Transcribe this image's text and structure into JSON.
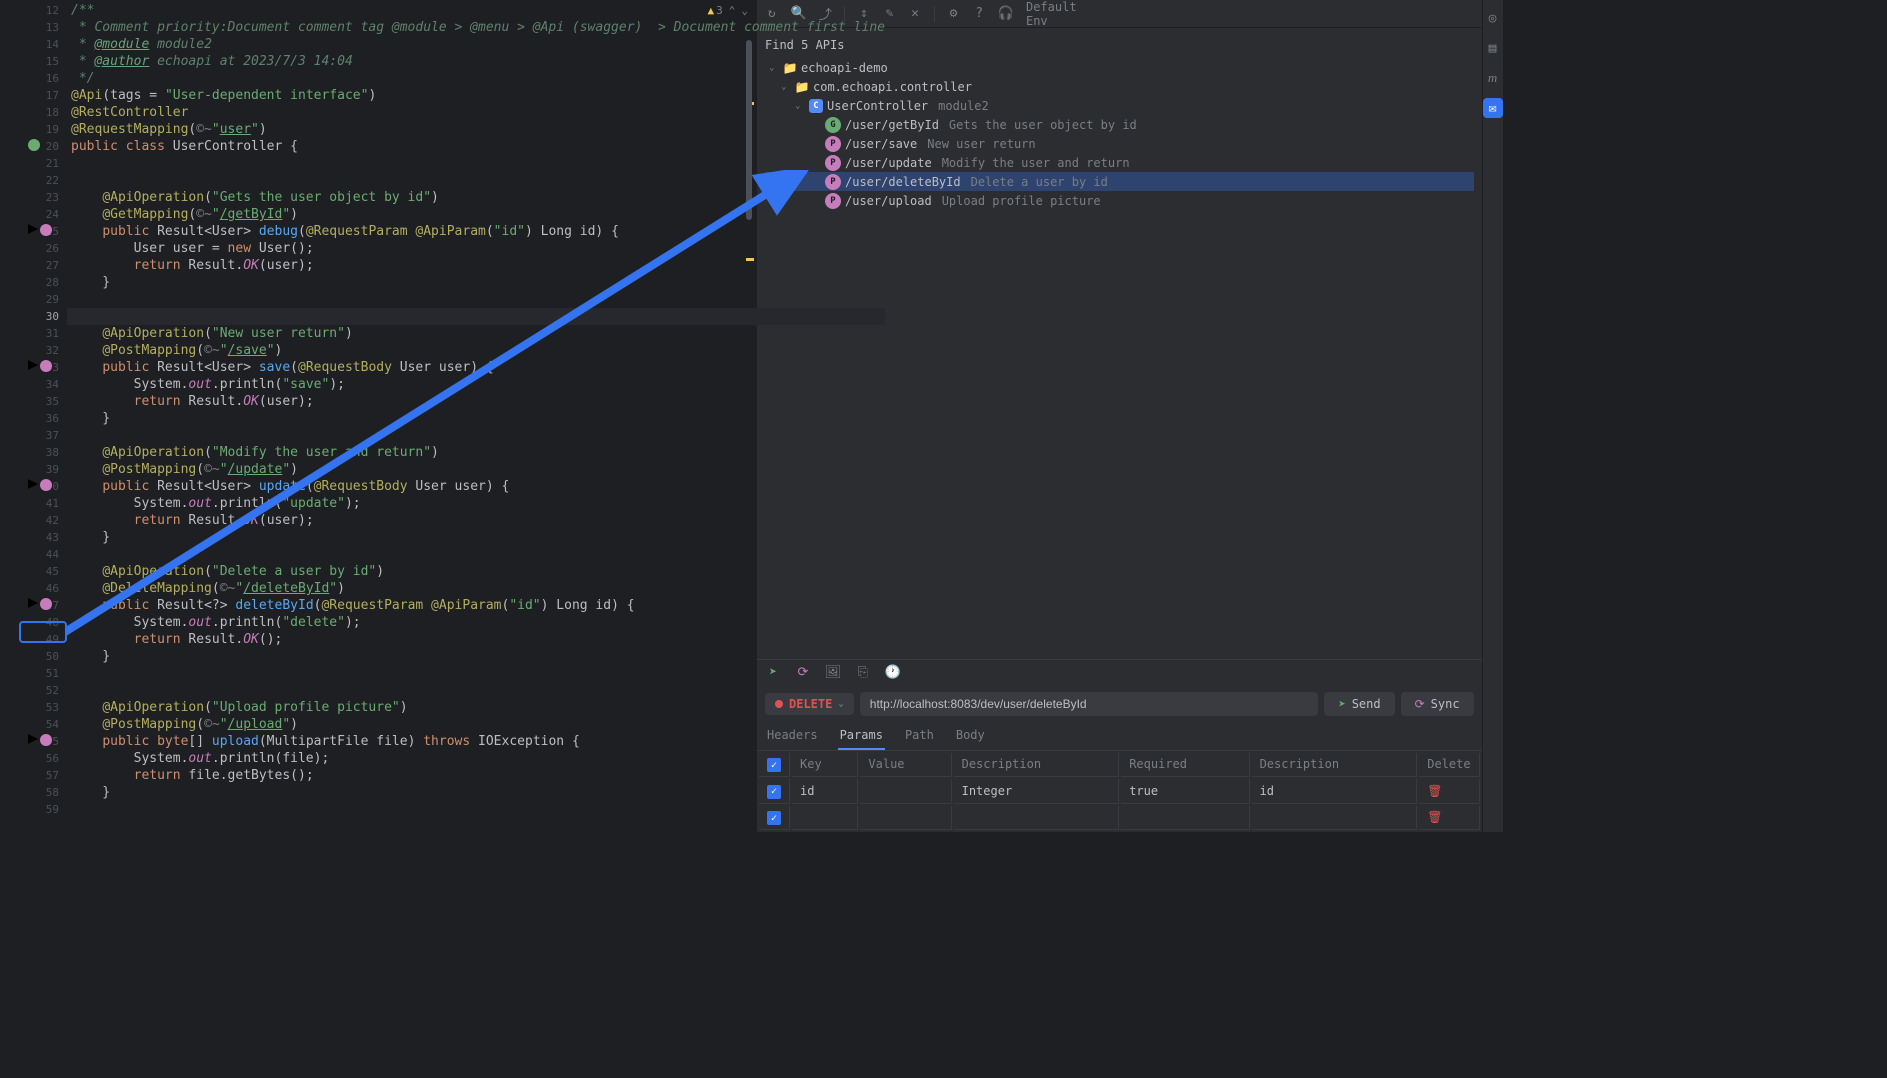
{
  "editor": {
    "warning_count": "3",
    "lines": [
      {
        "n": 12,
        "html": "<span class='c-doccomment'>/**</span>"
      },
      {
        "n": 13,
        "html": "<span class='c-doccomment'> * Comment priority:Document comment tag @module > @menu > @Api (swagger)  > Document comment first line</span>"
      },
      {
        "n": 14,
        "html": "<span class='c-doccomment'> * </span><span class='c-doctag'>@module</span><span class='c-doccomment'> module2</span>"
      },
      {
        "n": 15,
        "html": "<span class='c-doccomment'> * </span><span class='c-doctag'>@author</span><span class='c-doccomment'> echoapi at 2023/7/3 14:04</span>"
      },
      {
        "n": 16,
        "html": "<span class='c-doccomment'> */</span>"
      },
      {
        "n": 17,
        "html": "<span class='c-annotation'>@Api</span>(tags = <span class='c-string'>\"User-dependent interface\"</span>)"
      },
      {
        "n": 18,
        "html": "<span class='c-annotation'>@RestController</span>"
      },
      {
        "n": 19,
        "html": "<span class='c-annotation'>@RequestMapping</span>(<span class='c-comment'>©~</span><span class='c-string'>\"<u>user</u>\"</span>)"
      },
      {
        "n": 20,
        "html": "<span class='c-keyword'>public class</span> UserController {",
        "icon": "class"
      },
      {
        "n": 21,
        "html": ""
      },
      {
        "n": 22,
        "html": ""
      },
      {
        "n": 23,
        "html": "    <span class='c-annotation'>@ApiOperation</span>(<span class='c-string'>\"Gets the user object by id\"</span>)"
      },
      {
        "n": 24,
        "html": "    <span class='c-annotation'>@GetMapping</span>(<span class='c-comment'>©~</span><span class='c-string'>\"<u>/getById</u>\"</span>)"
      },
      {
        "n": 25,
        "html": "    <span class='c-keyword'>public</span> Result&lt;User&gt; <span class='c-method'>debug</span>(<span class='c-annotation'>@RequestParam @ApiParam</span>(<span class='c-string'>\"id\"</span>) Long id) {",
        "icon": "run"
      },
      {
        "n": 26,
        "html": "        User user = <span class='c-keyword'>new</span> User();"
      },
      {
        "n": 27,
        "html": "        <span class='c-keyword'>return</span> Result.<span class='c-static'>OK</span>(user);"
      },
      {
        "n": 28,
        "html": "    }"
      },
      {
        "n": 29,
        "html": ""
      },
      {
        "n": 30,
        "html": "",
        "hl": true
      },
      {
        "n": 31,
        "html": "    <span class='c-annotation'>@ApiOperation</span>(<span class='c-string'>\"New user return\"</span>)"
      },
      {
        "n": 32,
        "html": "    <span class='c-annotation'>@PostMapping</span>(<span class='c-comment'>©~</span><span class='c-string'>\"<u>/save</u>\"</span>)"
      },
      {
        "n": 33,
        "html": "    <span class='c-keyword'>public</span> Result&lt;User&gt; <span class='c-method'>save</span>(<span class='c-annotation'>@RequestBody</span> User user) {",
        "icon": "run"
      },
      {
        "n": 34,
        "html": "        System.<span class='c-static'>out</span>.println(<span class='c-string'>\"save\"</span>);"
      },
      {
        "n": 35,
        "html": "        <span class='c-keyword'>return</span> Result.<span class='c-static'>OK</span>(user);"
      },
      {
        "n": 36,
        "html": "    }"
      },
      {
        "n": 37,
        "html": ""
      },
      {
        "n": 38,
        "html": "    <span class='c-annotation'>@ApiOperation</span>(<span class='c-string'>\"Modify the user and return\"</span>)"
      },
      {
        "n": 39,
        "html": "    <span class='c-annotation'>@PostMapping</span>(<span class='c-comment'>©~</span><span class='c-string'>\"<u>/update</u>\"</span>)"
      },
      {
        "n": 40,
        "html": "    <span class='c-keyword'>public</span> Result&lt;User&gt; <span class='c-method'>update</span>(<span class='c-annotation'>@RequestBody</span> User user) {",
        "icon": "run"
      },
      {
        "n": 41,
        "html": "        System.<span class='c-static'>out</span>.println(<span class='c-string'>\"update\"</span>);"
      },
      {
        "n": 42,
        "html": "        <span class='c-keyword'>return</span> Result.<span class='c-static'>OK</span>(user);"
      },
      {
        "n": 43,
        "html": "    }"
      },
      {
        "n": 44,
        "html": ""
      },
      {
        "n": 45,
        "html": "    <span class='c-annotation'>@ApiOperation</span>(<span class='c-string'>\"Delete a user by id\"</span>)"
      },
      {
        "n": 46,
        "html": "    <span class='c-annotation'>@DeleteMapping</span>(<span class='c-comment'>©~</span><span class='c-string'>\"<u>/deleteById</u>\"</span>)"
      },
      {
        "n": 47,
        "html": "    <span class='c-keyword'>public</span> Result&lt;?&gt; <span class='c-method'>deleteById</span>(<span class='c-annotation'>@RequestParam @ApiParam</span>(<span class='c-string'>\"id\"</span>) Long id) {",
        "icon": "run"
      },
      {
        "n": 48,
        "html": "        System.<span class='c-static'>out</span>.println(<span class='c-string'>\"delete\"</span>);"
      },
      {
        "n": 49,
        "html": "        <span class='c-keyword'>return</span> Result.<span class='c-static'>OK</span>();"
      },
      {
        "n": 50,
        "html": "    }"
      },
      {
        "n": 51,
        "html": ""
      },
      {
        "n": 52,
        "html": ""
      },
      {
        "n": 53,
        "html": "    <span class='c-annotation'>@ApiOperation</span>(<span class='c-string'>\"Upload profile picture\"</span>)"
      },
      {
        "n": 54,
        "html": "    <span class='c-annotation'>@PostMapping</span>(<span class='c-comment'>©~</span><span class='c-string'>\"<u>/upload</u>\"</span>)"
      },
      {
        "n": 55,
        "html": "    <span class='c-keyword'>public byte</span>[] <span class='c-method'>upload</span>(MultipartFile file) <span class='c-keyword'>throws</span> IOException {",
        "icon": "run"
      },
      {
        "n": 56,
        "html": "        System.<span class='c-static'>out</span>.println(file);"
      },
      {
        "n": 57,
        "html": "        <span class='c-keyword'>return</span> file.getBytes();"
      },
      {
        "n": 58,
        "html": "    }"
      },
      {
        "n": 59,
        "html": ""
      }
    ]
  },
  "api_panel": {
    "env_label": "Default Env",
    "find_title": "Find 5 APIs",
    "tree": {
      "project": "echoapi-demo",
      "package": "com.echoapi.controller",
      "controller": "UserController",
      "module": "module2",
      "endpoints": [
        {
          "method": "G",
          "cls": "http-get",
          "path": "/user/getById",
          "desc": "Gets the user object by id"
        },
        {
          "method": "P",
          "cls": "http-post",
          "path": "/user/save",
          "desc": "New user return"
        },
        {
          "method": "P",
          "cls": "http-post",
          "path": "/user/update",
          "desc": "Modify the user and return"
        },
        {
          "method": "P",
          "cls": "http-post",
          "path": "/user/deleteById",
          "desc": "Delete a user by id",
          "selected": true
        },
        {
          "method": "P",
          "cls": "http-post",
          "path": "/user/upload",
          "desc": "Upload profile picture"
        }
      ]
    }
  },
  "request": {
    "method": "DELETE",
    "url": "http://localhost:8083/dev/user/deleteById",
    "send_label": "Send",
    "sync_label": "Sync",
    "tabs": [
      "Headers",
      "Params",
      "Path",
      "Body"
    ],
    "active_tab": 1,
    "table_headers": [
      "Key",
      "Value",
      "Description",
      "Required",
      "Description",
      "Delete"
    ],
    "rows": [
      {
        "key": "id",
        "value": "",
        "type": "Integer",
        "required": "true",
        "desc": "id"
      }
    ]
  }
}
